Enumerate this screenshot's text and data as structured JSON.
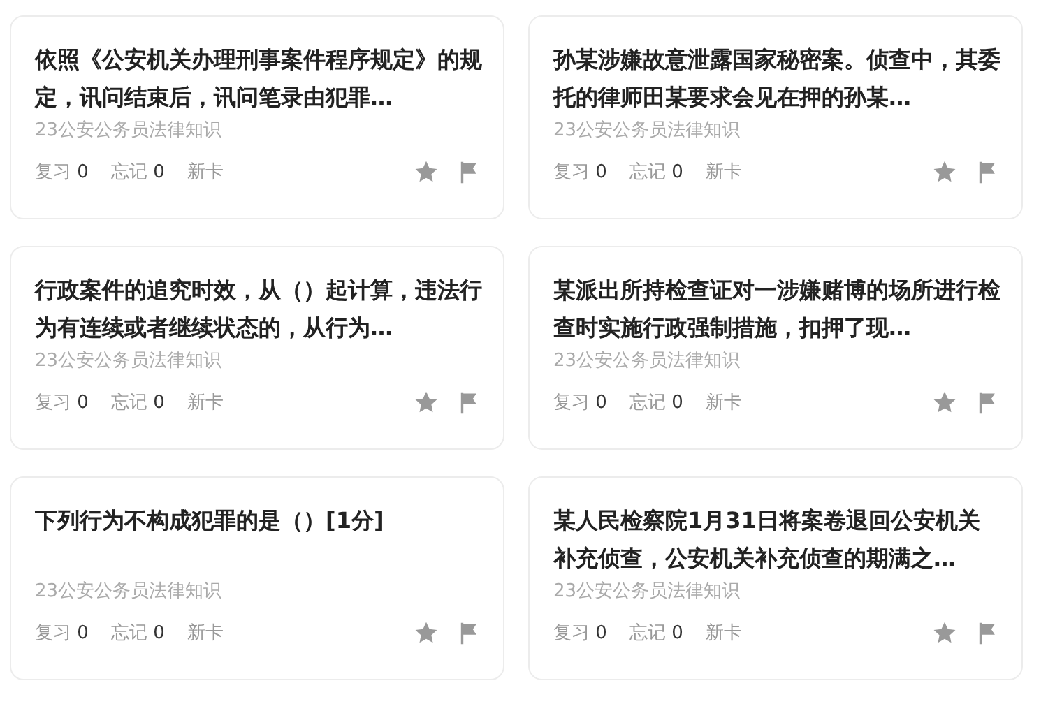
{
  "cards": [
    {
      "question": "依照《公安机关办理刑事案件程序规定》的规定，讯问结束后，讯问笔录由犯罪…",
      "deck": "23公安公务员法律知识",
      "review_label": "复习",
      "review_count": "0",
      "forget_label": "忘记",
      "forget_count": "0",
      "status": "新卡"
    },
    {
      "question": "孙某涉嫌故意泄露国家秘密案。侦查中，其委托的律师田某要求会见在押的孙某…",
      "deck": "23公安公务员法律知识",
      "review_label": "复习",
      "review_count": "0",
      "forget_label": "忘记",
      "forget_count": "0",
      "status": "新卡"
    },
    {
      "question": "行政案件的追究时效，从（）起计算，违法行为有连续或者继续状态的，从行为…",
      "deck": "23公安公务员法律知识",
      "review_label": "复习",
      "review_count": "0",
      "forget_label": "忘记",
      "forget_count": "0",
      "status": "新卡"
    },
    {
      "question": "某派出所持检查证对一涉嫌赌博的场所进行检查时实施行政强制措施，扣押了现…",
      "deck": "23公安公务员法律知识",
      "review_label": "复习",
      "review_count": "0",
      "forget_label": "忘记",
      "forget_count": "0",
      "status": "新卡"
    },
    {
      "question": "下列行为不构成犯罪的是（）[1分]",
      "deck": "23公安公务员法律知识",
      "review_label": "复习",
      "review_count": "0",
      "forget_label": "忘记",
      "forget_count": "0",
      "status": "新卡"
    },
    {
      "question": "某人民检察院1月31日将案卷退回公安机关补充侦查，公安机关补充侦查的期满之…",
      "deck": "23公安公务员法律知识",
      "review_label": "复习",
      "review_count": "0",
      "forget_label": "忘记",
      "forget_count": "0",
      "status": "新卡"
    }
  ]
}
